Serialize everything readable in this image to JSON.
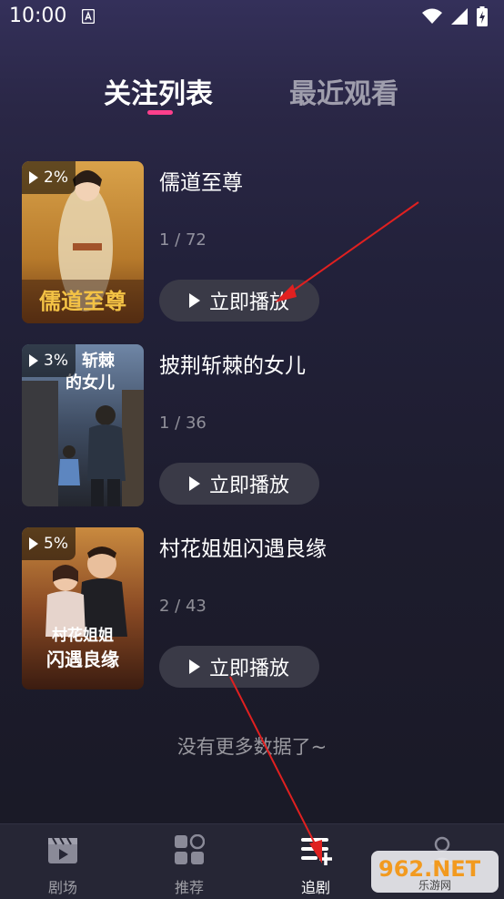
{
  "status_bar": {
    "time": "10:00"
  },
  "tabs": [
    {
      "label": "关注列表",
      "active": true
    },
    {
      "label": "最近观看",
      "active": false
    }
  ],
  "items": [
    {
      "title": "儒道至尊",
      "progress": "2%",
      "episodes": "1 / 72",
      "play_label": "立即播放",
      "poster_text": "儒道至尊"
    },
    {
      "title": "披荆斩棘的女儿",
      "progress": "3%",
      "episodes": "1 / 36",
      "play_label": "立即播放",
      "poster_text_1": "斩棘",
      "poster_text_2": "的女儿"
    },
    {
      "title": "村花姐姐闪遇良缘",
      "progress": "5%",
      "episodes": "2 / 43",
      "play_label": "立即播放",
      "poster_text_1": "村花姐姐",
      "poster_text_2": "闪遇良缘"
    }
  ],
  "footer": {
    "text": "没有更多数据了~"
  },
  "bottom_nav": [
    {
      "label": "剧场",
      "icon": "film-icon",
      "active": false
    },
    {
      "label": "推荐",
      "icon": "grid-icon",
      "active": false
    },
    {
      "label": "追剧",
      "icon": "list-add-icon",
      "active": true
    },
    {
      "label": "",
      "icon": "profile-icon",
      "active": false
    }
  ],
  "watermark": {
    "brand": "962.NET",
    "sub": "乐游网"
  },
  "colors": {
    "accent": "#ff3f8c",
    "annotation_arrow": "#e02020",
    "button_bg": "#3a3a47",
    "nav_bg": "#262635"
  }
}
